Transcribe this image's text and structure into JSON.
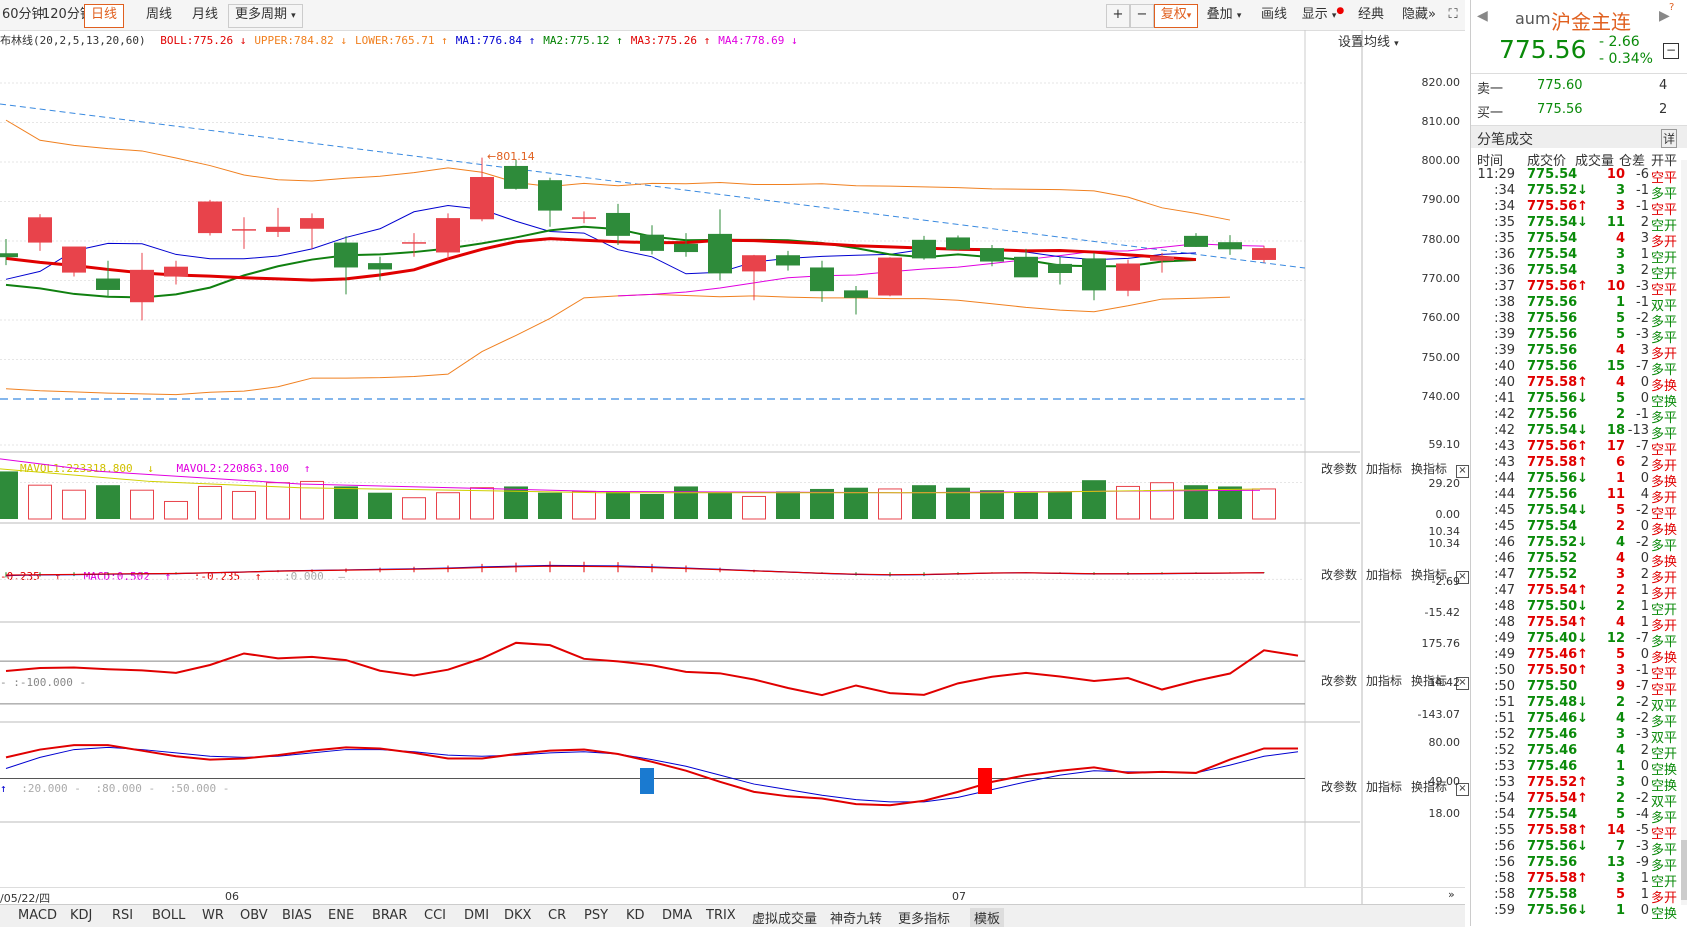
{
  "toolbar": {
    "period_tabs": [
      "60分钟",
      "120分钟",
      "日线",
      "周线",
      "月线",
      "更多周期"
    ],
    "right_buttons": [
      "复权",
      "叠加",
      "画线",
      "显示",
      "经典",
      "隐藏"
    ]
  },
  "main_legend": {
    "name": "布林线(20,2,5,13,20,60)",
    "items": [
      "BOLL:775.26",
      "UPPER:784.82",
      "LOWER:765.71",
      "MA1:776.84",
      "MA2:775.12",
      "MA3:775.26",
      "MA4:778.69"
    ],
    "arrows": [
      "↓",
      "↓",
      "↑",
      "↑",
      "↑",
      "↑",
      "↓"
    ],
    "colors": [
      "#e00000",
      "#f08020",
      "#f08020",
      "#0000d0",
      "#008000",
      "#e00000",
      "#e000e0"
    ],
    "set_ma": "设置均线",
    "peak_label": "801.14"
  },
  "main_axis": [
    "820.00",
    "810.00",
    "800.00",
    "790.00",
    "780.00",
    "770.00",
    "760.00",
    "750.00",
    "740.00"
  ],
  "vol_legend": {
    "items": [
      "MAVOL1:223318.800",
      "MAVOL2:220863.100"
    ],
    "arrows": [
      "↓",
      "↑"
    ]
  },
  "vol_axis": [
    "59.10",
    "29.20",
    "0.00"
  ],
  "macd_legend": {
    "items": [
      "-0.235",
      "MACD:0.502",
      ":-0.235",
      ":0.000"
    ],
    "arrows": [
      "↑",
      "↑",
      "↑",
      "—"
    ]
  },
  "macd_axis": [
    "10.34",
    "10.34",
    "-2.69",
    "-15.42"
  ],
  "cci_legend": {
    "items": [
      "- :-100.000 -"
    ]
  },
  "cci_axis": [
    "175.76",
    "14.42",
    "-143.07"
  ],
  "kd_legend": {
    "items": [
      ":20.000 -",
      ":80.000 -",
      ":50.000 -"
    ]
  },
  "kd_axis": [
    "80.00",
    "49.00",
    "18.00"
  ],
  "panel_controls": [
    "改参数",
    "加指标",
    "换指标"
  ],
  "date_axis": [
    "/05/22/四",
    "06",
    "07"
  ],
  "bottom_tabs": [
    "MACD",
    "KDJ",
    "RSI",
    "BOLL",
    "WR",
    "OBV",
    "BIAS",
    "ENE",
    "BRAR",
    "CCI",
    "DMI",
    "DKX",
    "CR",
    "PSY",
    "KD",
    "DMA",
    "TRIX",
    "虚拟成交量",
    "神奇九转",
    "更多指标",
    "模板"
  ],
  "quote": {
    "code": "aum",
    "name": "沪金主连",
    "price": "775.56",
    "change": "- 2.66",
    "change_pct": "- 0.34%",
    "sell1_label": "卖一",
    "sell1_price": "775.60",
    "sell1_vol": "4",
    "buy1_label": "买一",
    "buy1_price": "775.56",
    "buy1_vol": "2",
    "ticks_title": "分笔成交",
    "ticks_detail": "详",
    "ticks_headers": [
      "时间",
      "成交价",
      "成交量",
      "仓差",
      "开平"
    ]
  },
  "ticks": [
    [
      "11:29",
      "775.54",
      "",
      "10",
      "-6",
      "空平",
      "r"
    ],
    [
      ":34",
      "775.52",
      "↓",
      "3",
      "-1",
      "多平",
      "g"
    ],
    [
      ":34",
      "775.56",
      "↑",
      "3",
      "-1",
      "空平",
      "r"
    ],
    [
      ":35",
      "775.54",
      "↓",
      "11",
      "2",
      "空开",
      "g"
    ],
    [
      ":35",
      "775.54",
      "",
      "4",
      "3",
      "多开",
      "r"
    ],
    [
      ":36",
      "775.54",
      "",
      "3",
      "1",
      "空开",
      "g"
    ],
    [
      ":36",
      "775.54",
      "",
      "3",
      "2",
      "空开",
      "g"
    ],
    [
      ":37",
      "775.56",
      "↑",
      "10",
      "-3",
      "空平",
      "r"
    ],
    [
      ":38",
      "775.56",
      "",
      "1",
      "-1",
      "双平",
      "g"
    ],
    [
      ":38",
      "775.56",
      "",
      "5",
      "-2",
      "多平",
      "g"
    ],
    [
      ":39",
      "775.56",
      "",
      "5",
      "-3",
      "多平",
      "g"
    ],
    [
      ":39",
      "775.56",
      "",
      "4",
      "3",
      "多开",
      "r"
    ],
    [
      ":40",
      "775.56",
      "",
      "15",
      "-7",
      "多平",
      "g"
    ],
    [
      ":40",
      "775.58",
      "↑",
      "4",
      "0",
      "多换",
      "r"
    ],
    [
      ":41",
      "775.56",
      "↓",
      "5",
      "0",
      "空换",
      "g"
    ],
    [
      ":42",
      "775.56",
      "",
      "2",
      "-1",
      "多平",
      "g"
    ],
    [
      ":42",
      "775.54",
      "↓",
      "18",
      "-13",
      "多平",
      "g"
    ],
    [
      ":43",
      "775.56",
      "↑",
      "17",
      "-7",
      "空平",
      "r"
    ],
    [
      ":43",
      "775.58",
      "↑",
      "6",
      "2",
      "多开",
      "r"
    ],
    [
      ":44",
      "775.56",
      "↓",
      "1",
      "0",
      "多换",
      "r"
    ],
    [
      ":44",
      "775.56",
      "",
      "11",
      "4",
      "多开",
      "r"
    ],
    [
      ":45",
      "775.54",
      "↓",
      "5",
      "-2",
      "空平",
      "r"
    ],
    [
      ":45",
      "775.54",
      "",
      "2",
      "0",
      "多换",
      "r"
    ],
    [
      ":46",
      "775.52",
      "↓",
      "4",
      "-2",
      "多平",
      "g"
    ],
    [
      ":46",
      "775.52",
      "",
      "4",
      "0",
      "多换",
      "r"
    ],
    [
      ":47",
      "775.52",
      "",
      "3",
      "2",
      "多开",
      "r"
    ],
    [
      ":47",
      "775.54",
      "↑",
      "2",
      "1",
      "多开",
      "r"
    ],
    [
      ":48",
      "775.50",
      "↓",
      "2",
      "1",
      "空开",
      "g"
    ],
    [
      ":48",
      "775.54",
      "↑",
      "4",
      "1",
      "多开",
      "r"
    ],
    [
      ":49",
      "775.40",
      "↓",
      "12",
      "-7",
      "多平",
      "g"
    ],
    [
      ":49",
      "775.46",
      "↑",
      "5",
      "0",
      "多换",
      "r"
    ],
    [
      ":50",
      "775.50",
      "↑",
      "3",
      "-1",
      "空平",
      "r"
    ],
    [
      ":50",
      "775.50",
      "",
      "9",
      "-7",
      "空平",
      "r"
    ],
    [
      ":51",
      "775.48",
      "↓",
      "2",
      "-2",
      "双平",
      "g"
    ],
    [
      ":51",
      "775.46",
      "↓",
      "4",
      "-2",
      "多平",
      "g"
    ],
    [
      ":52",
      "775.46",
      "",
      "3",
      "-3",
      "双平",
      "g"
    ],
    [
      ":52",
      "775.46",
      "",
      "4",
      "2",
      "空开",
      "g"
    ],
    [
      ":53",
      "775.46",
      "",
      "1",
      "0",
      "空换",
      "g"
    ],
    [
      ":53",
      "775.52",
      "↑",
      "3",
      "0",
      "空换",
      "g"
    ],
    [
      ":54",
      "775.54",
      "↑",
      "2",
      "-2",
      "双平",
      "g"
    ],
    [
      ":54",
      "775.54",
      "",
      "5",
      "-4",
      "多平",
      "g"
    ],
    [
      ":55",
      "775.58",
      "↑",
      "14",
      "-5",
      "空平",
      "r"
    ],
    [
      ":56",
      "775.56",
      "↓",
      "7",
      "-3",
      "多平",
      "g"
    ],
    [
      ":56",
      "775.56",
      "",
      "13",
      "-9",
      "多平",
      "g"
    ],
    [
      ":58",
      "775.58",
      "↑",
      "3",
      "1",
      "空开",
      "g"
    ],
    [
      ":58",
      "775.58",
      "",
      "5",
      "1",
      "多开",
      "r"
    ],
    [
      ":59",
      "775.56",
      "↓",
      "1",
      "0",
      "空换",
      "g"
    ]
  ],
  "chart_data": {
    "type": "candlestick",
    "ylim": [
      736,
      826
    ],
    "candles": [
      [
        776.9,
        780.5,
        773.9,
        775.9
      ],
      [
        779.6,
        786.8,
        777.5,
        786.0
      ],
      [
        772.0,
        777.8,
        771.0,
        778.6
      ],
      [
        770.5,
        775.0,
        765.9,
        767.6
      ],
      [
        764.5,
        777.0,
        759.9,
        772.7
      ],
      [
        771.0,
        775.0,
        769.0,
        773.5
      ],
      [
        782.0,
        790.4,
        781.4,
        790.0
      ],
      [
        783.0,
        786.0,
        778.0,
        783.0
      ],
      [
        782.3,
        788.4,
        781.0,
        783.6
      ],
      [
        783.1,
        787.0,
        778.0,
        785.8
      ],
      [
        779.6,
        781.2,
        766.5,
        773.3
      ],
      [
        774.4,
        776.0,
        770.0,
        772.8
      ],
      [
        779.7,
        782.0,
        776.0,
        779.7
      ],
      [
        777.1,
        787.0,
        775.4,
        785.8
      ],
      [
        785.5,
        801.1,
        785.0,
        796.2
      ],
      [
        799.0,
        800.5,
        793.0,
        793.2
      ],
      [
        795.4,
        796.0,
        783.6,
        787.7
      ],
      [
        786.0,
        787.5,
        784.5,
        786.0
      ],
      [
        787.1,
        789.4,
        779.0,
        781.3
      ],
      [
        781.6,
        784.0,
        776.6,
        777.5
      ],
      [
        779.3,
        782.0,
        776.0,
        777.2
      ],
      [
        781.8,
        788.0,
        770.0,
        771.8
      ],
      [
        772.3,
        776.5,
        765.0,
        776.4
      ],
      [
        776.4,
        777.5,
        772.5,
        773.8
      ],
      [
        773.3,
        775.0,
        764.6,
        767.3
      ],
      [
        767.5,
        768.6,
        761.4,
        765.6
      ],
      [
        766.2,
        775.9,
        766.0,
        775.8
      ],
      [
        780.3,
        781.3,
        775.3,
        775.6
      ],
      [
        780.9,
        781.4,
        777.6,
        777.8
      ],
      [
        778.2,
        779.0,
        773.6,
        774.8
      ],
      [
        776.0,
        778.0,
        771.7,
        770.8
      ],
      [
        774.2,
        776.0,
        769.0,
        771.9
      ],
      [
        775.6,
        777.0,
        765.0,
        767.5
      ],
      [
        767.4,
        775.3,
        766.0,
        774.3
      ],
      [
        775.0,
        777.0,
        772.0,
        776.1
      ],
      [
        781.3,
        782.0,
        778.5,
        778.5
      ],
      [
        779.7,
        781.5,
        776.5,
        777.9
      ],
      [
        775.2,
        778.8,
        774.5,
        778.2
      ]
    ],
    "upper": [
      810.6,
      805.5,
      804.2,
      803.4,
      802.8,
      801.0,
      799.1,
      796.7,
      795.5,
      795.2,
      795.9,
      796.4,
      797.3,
      798.5,
      797.4,
      794.8,
      793.8,
      794.6,
      794.0,
      794.6,
      794.5,
      794.8,
      794.3,
      794.3,
      794.5,
      794.0,
      793.9,
      793.7,
      793.5,
      793.2,
      793.1,
      793.0,
      792.7,
      791.1,
      788.4,
      787.0,
      785.3
    ],
    "lower": [
      742.6,
      742.1,
      741.8,
      741.5,
      741.3,
      741.1,
      741.7,
      742.0,
      743.1,
      745.3,
      745.3,
      745.4,
      745.7,
      746.3,
      752.0,
      756.1,
      760.4,
      765.6,
      766.1,
      766.5,
      766.2,
      765.9,
      766.1,
      765.8,
      765.6,
      765.6,
      765.4,
      765.4,
      765.0,
      764.1,
      763.2,
      762.5,
      762.1,
      763.6,
      765.3,
      765.5,
      765.8
    ],
    "ma_green": [
      768.9,
      768.0,
      766.6,
      765.9,
      765.7,
      766.5,
      768.2,
      771.3,
      773.6,
      775.3,
      776.4,
      776.6,
      777.2,
      778.1,
      779.4,
      780.9,
      782.7,
      783.6,
      783.0,
      781.1,
      780.2,
      780.3,
      780.3,
      780.2,
      779.5,
      778.2,
      776.6,
      775.9,
      776.6,
      775.9,
      775.2,
      773.8,
      773.6,
      773.6,
      774.8,
      775.2
    ],
    "ma_blue": [
      770.3,
      772.3,
      777.5,
      779.4,
      779.3,
      776.6,
      775.5,
      775.5,
      776.2,
      778.0,
      780.9,
      783.1,
      787.4,
      789.0,
      788.0,
      785.0,
      782.4,
      782.0,
      777.8,
      776.0,
      771.7,
      772.1,
      774.7,
      775.6,
      776.1,
      776.4,
      776.6,
      777.9,
      778.3,
      777.8,
      777.2,
      776.0,
      775.3,
      775.6,
      776.6,
      777.0
    ],
    "ma_red": [
      775.6,
      774.6,
      773.8,
      772.8,
      771.9,
      771.4,
      771.1,
      770.7,
      770.4,
      770.1,
      770.4,
      771.4,
      772.7,
      775.5,
      777.9,
      779.8,
      780.6,
      780.2,
      779.8,
      779.6,
      779.6,
      780.2,
      780.1,
      779.7,
      779.3,
      778.8,
      778.5,
      778.2,
      777.9,
      777.8,
      777.5,
      777.6,
      777.2,
      776.5,
      775.9,
      775.3
    ],
    "ma_magenta": [
      766.1,
      766.5,
      767.1,
      768.1,
      769.4,
      770.7,
      771.2,
      771.4,
      772.2,
      772.9,
      773.4,
      774.3,
      775.3,
      776.3,
      777.4,
      777.5,
      778.4,
      779.3,
      778.9,
      778.7
    ],
    "vol": [
      38,
      27,
      23,
      27,
      23,
      14,
      26,
      22,
      29,
      30,
      26,
      21,
      17,
      21,
      25,
      26,
      21,
      22,
      22,
      20,
      26,
      21,
      18,
      22,
      24,
      25,
      24,
      27,
      25,
      23,
      21,
      22,
      31,
      26,
      29,
      27,
      26,
      24
    ],
    "macd_dif": [
      -1.2,
      -1.0,
      -0.9,
      -0.7,
      -0.6,
      -0.5,
      -0.2,
      0.1,
      0.5,
      0.7,
      0.9,
      1.1,
      1.3,
      1.6,
      2.0,
      2.3,
      2.6,
      2.5,
      2.4,
      2.0,
      1.6,
      1.1,
      0.6,
      0.1,
      -0.4,
      -0.8,
      -1.0,
      -0.9,
      -0.6,
      -0.3,
      -0.2,
      -0.4,
      -0.6,
      -0.6,
      -0.5,
      -0.4,
      -0.3,
      -0.2
    ],
    "cci": [
      54,
      68,
      70,
      62,
      57,
      45,
      82,
      136,
      113,
      120,
      105,
      55,
      33,
      60,
      113,
      186,
      175,
      111,
      99,
      81,
      50,
      43,
      14,
      -26,
      -59,
      -14,
      -50,
      -58,
      -4,
      27,
      45,
      28,
      7,
      21,
      -33,
      8,
      42,
      151,
      126
    ],
    "kd_k": [
      68,
      75,
      79,
      79,
      74,
      69,
      66,
      67,
      70,
      74,
      77,
      76,
      72,
      67,
      67,
      71,
      74,
      75,
      71,
      64,
      56,
      46,
      37,
      33,
      31,
      26,
      25,
      29,
      37,
      46,
      52,
      56,
      59,
      54,
      55,
      54,
      66,
      76,
      76
    ],
    "kd_d": [
      58,
      68,
      75,
      77,
      75,
      72,
      69,
      68,
      69,
      72,
      75,
      75,
      73,
      70,
      69,
      70,
      72,
      73,
      71,
      66,
      60,
      52,
      44,
      39,
      34,
      30,
      28,
      28,
      32,
      39,
      46,
      52,
      56,
      55,
      55,
      54,
      61,
      69,
      73
    ]
  }
}
